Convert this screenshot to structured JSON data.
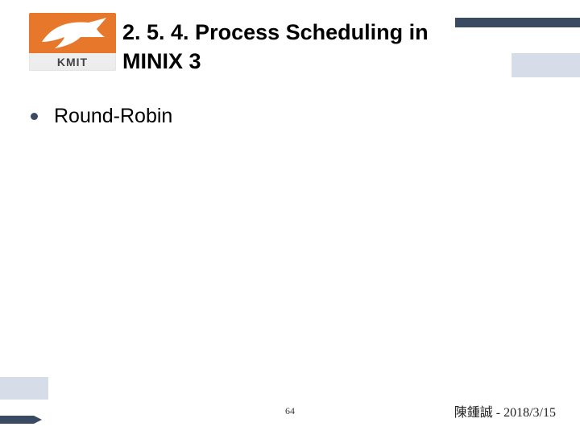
{
  "logo": {
    "label": "KMIT"
  },
  "title": "2. 5. 4. Process Scheduling in MINIX 3",
  "bullets": [
    {
      "text": "Round-Robin"
    }
  ],
  "footer": {
    "page": "64",
    "author": "陳鍾誠",
    "separator": " - ",
    "date": "2018/3/15"
  }
}
